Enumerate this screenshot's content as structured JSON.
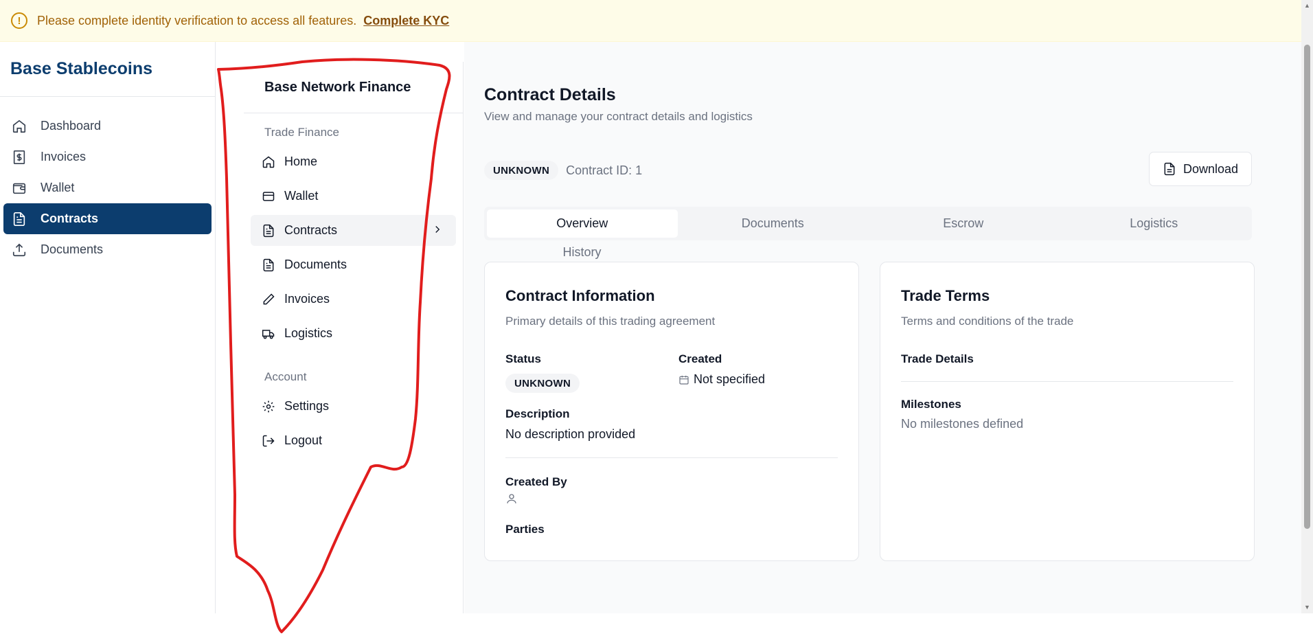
{
  "banner": {
    "icon": "alert-circle-icon",
    "message": "Please complete identity verification to access all features.",
    "link_label": "Complete KYC"
  },
  "app_sidebar": {
    "brand": "Base Stablecoins",
    "items": [
      {
        "label": "Dashboard",
        "icon": "home-icon"
      },
      {
        "label": "Invoices",
        "icon": "dollar-receipt-icon"
      },
      {
        "label": "Wallet",
        "icon": "wallet-icon"
      },
      {
        "label": "Contracts",
        "icon": "file-text-icon",
        "active": true
      },
      {
        "label": "Documents",
        "icon": "upload-icon"
      }
    ]
  },
  "sub_sidebar": {
    "brand": "Base Network Finance",
    "group_trade": "Trade Finance",
    "trade_items": [
      {
        "label": "Home",
        "icon": "home-icon"
      },
      {
        "label": "Wallet",
        "icon": "credit-card-icon"
      },
      {
        "label": "Contracts",
        "icon": "file-text-icon",
        "active": true
      },
      {
        "label": "Documents",
        "icon": "file-text-icon"
      },
      {
        "label": "Invoices",
        "icon": "pencil-icon"
      },
      {
        "label": "Logistics",
        "icon": "truck-icon"
      }
    ],
    "group_account": "Account",
    "account_items": [
      {
        "label": "Settings",
        "icon": "gear-icon"
      },
      {
        "label": "Logout",
        "icon": "logout-icon"
      }
    ]
  },
  "main": {
    "title": "Contract Details",
    "subtitle": "View and manage your contract details and logistics",
    "status_badge": "UNKNOWN",
    "contract_id": "Contract ID: 1",
    "download_label": "Download",
    "tabs": [
      "Overview",
      "Documents",
      "Escrow",
      "Logistics"
    ],
    "tab_history": "History",
    "contract_info": {
      "title": "Contract Information",
      "subtitle": "Primary details of this trading agreement",
      "status_label": "Status",
      "status_value": "UNKNOWN",
      "created_label": "Created",
      "created_value": "Not specified",
      "description_label": "Description",
      "description_value": "No description provided",
      "created_by_label": "Created By",
      "parties_label": "Parties"
    },
    "trade_terms": {
      "title": "Trade Terms",
      "subtitle": "Terms and conditions of the trade",
      "trade_details_label": "Trade Details",
      "milestones_label": "Milestones",
      "milestones_value": "No milestones defined"
    }
  },
  "annotation_color": "#e11d1d"
}
